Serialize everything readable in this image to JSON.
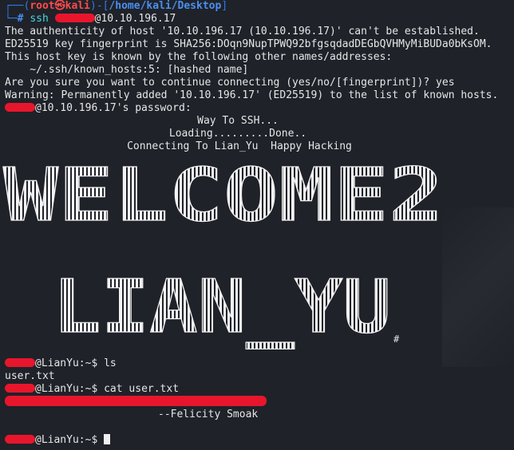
{
  "prompt1": {
    "corner": "┌──(",
    "user": "root",
    "skull": "㉿",
    "host": "kali",
    "mid": ")-[",
    "path": "/home/kali/Desktop",
    "end": "]",
    "line2": "└─",
    "hash": "#",
    "command": "ssh",
    "target": "@10.10.196.17"
  },
  "ssh_output": [
    "The authenticity of host '10.10.196.17 (10.10.196.17)' can't be established.",
    "ED25519 key fingerprint is SHA256:DOqn9NupTPWQ92bfgsqdadDEGbQVHMyMiBUDa0bKsOM.",
    "This host key is known by the following other names/addresses:",
    "    ~/.ssh/known_hosts:5: [hashed name]",
    "Are you sure you want to continue connecting (yes/no/[fingerprint])? yes",
    "Warning: Permanently added '10.10.196.17' (ED25519) to the list of known hosts."
  ],
  "password_prompt": "@10.10.196.17's password:",
  "banner": {
    "line1": "Way To SSH...",
    "line2": "Loading.........Done..",
    "line3": "Connecting To Lian_Yu  Happy Hacking"
  },
  "ascii_art": {
    "line1": "WELCOME2",
    "line2": "LIAN_YU",
    "hash": "#"
  },
  "session": {
    "prompt_host": "@LianYu:~$",
    "cmd1": "ls",
    "ls_output": "user.txt",
    "cmd2": "cat user.txt",
    "signature": "--Felicity Smoak"
  },
  "colors": {
    "background": "#1f2229",
    "redaction": "#e8162c",
    "prompt_blue": "#2d7be6"
  }
}
